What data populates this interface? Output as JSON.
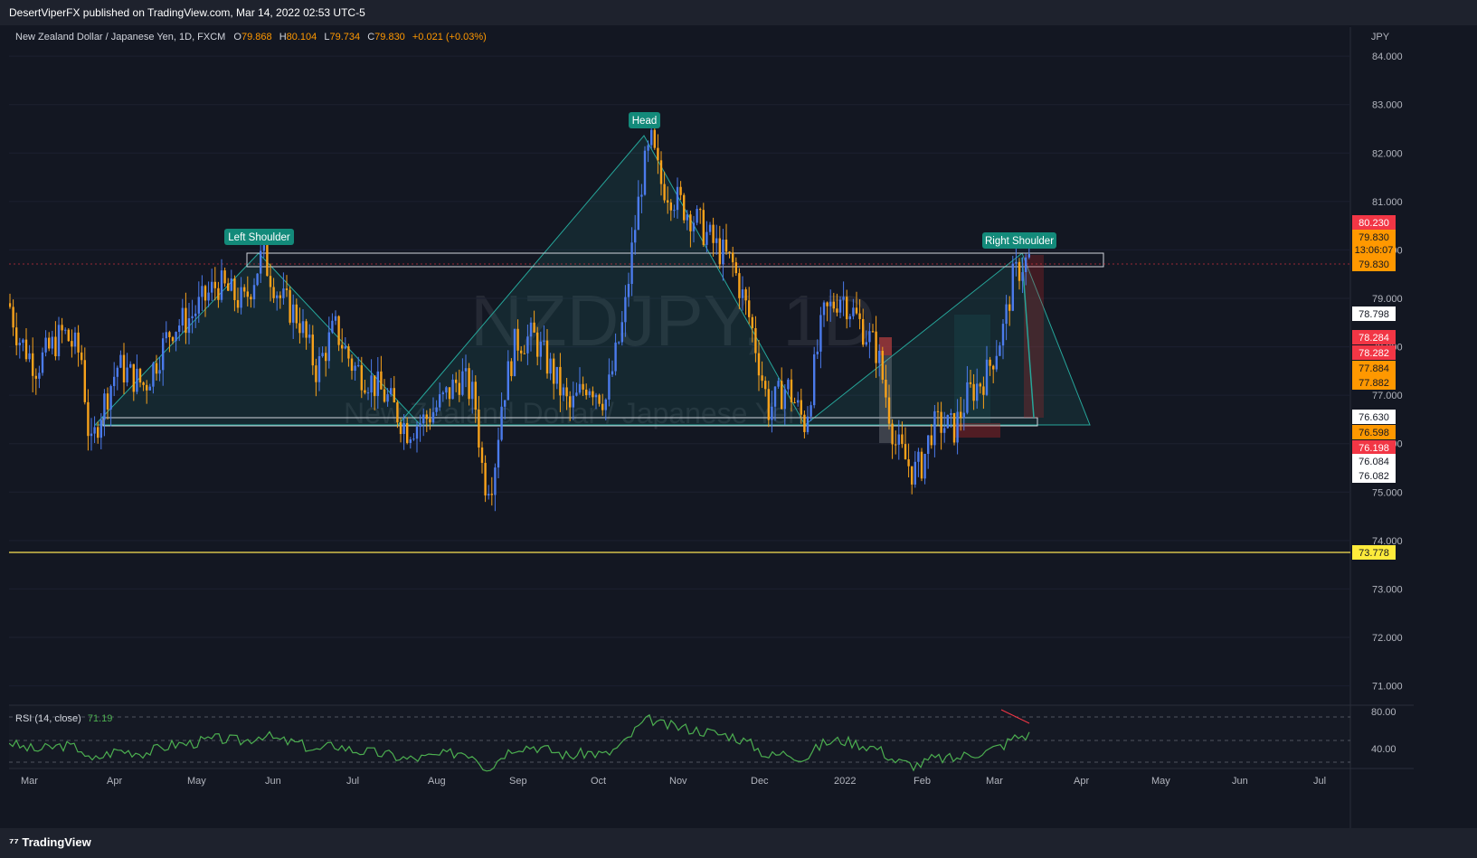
{
  "publisher": "DesertViperFX published on TradingView.com, Mar 14, 2022 02:53 UTC-5",
  "legend": {
    "symbol": "New Zealand Dollar / Japanese Yen, 1D, FXCM",
    "o_label": "O",
    "o": "79.868",
    "h_label": "H",
    "h": "80.104",
    "l_label": "L",
    "l": "79.734",
    "c_label": "C",
    "c": "79.830",
    "change": "+0.021 (+0.03%)"
  },
  "watermark": {
    "main": "NZDJPY, 1D",
    "sub": "New Zealand Dollar / Japanese Yen"
  },
  "currency": "JPY",
  "price_ticks": [
    "84.000",
    "83.000",
    "82.000",
    "81.000",
    "80.000",
    "79.000",
    "78.000",
    "77.000",
    "76.000",
    "75.000",
    "74.000",
    "73.000",
    "72.000",
    "71.000"
  ],
  "price_badges": [
    {
      "text": "80.230",
      "bg": "#f23645",
      "fg": "#ffffff"
    },
    {
      "text": "79.830",
      "bg": "#ff9800",
      "fg": "#131722"
    },
    {
      "text": "13:06:07",
      "bg": "#ff9800",
      "fg": "#131722"
    },
    {
      "text": "79.830",
      "bg": "#ff9800",
      "fg": "#131722"
    },
    {
      "text": "78.798",
      "bg": "#ffffff",
      "fg": "#131722"
    },
    {
      "text": "78.284",
      "bg": "#f23645",
      "fg": "#ffffff"
    },
    {
      "text": "78.282",
      "bg": "#f23645",
      "fg": "#ffffff"
    },
    {
      "text": "77.884",
      "bg": "#ff9800",
      "fg": "#131722"
    },
    {
      "text": "77.882",
      "bg": "#ff9800",
      "fg": "#131722"
    },
    {
      "text": "76.630",
      "bg": "#ffffff",
      "fg": "#131722"
    },
    {
      "text": "76.598",
      "bg": "#ff9800",
      "fg": "#131722"
    },
    {
      "text": "76.198",
      "bg": "#f23645",
      "fg": "#ffffff"
    },
    {
      "text": "76.084",
      "bg": "#ffffff",
      "fg": "#131722"
    },
    {
      "text": "76.082",
      "bg": "#ffffff",
      "fg": "#131722"
    },
    {
      "text": "73.778",
      "bg": "#ffeb3b",
      "fg": "#131722"
    }
  ],
  "pattern_labels": {
    "left": "Left Shoulder",
    "head": "Head",
    "right": "Right Shoulder"
  },
  "rsi": {
    "label": "RSI (14, close)",
    "value": "71.19",
    "ticks": [
      "80.00",
      "40.00"
    ]
  },
  "time_labels": [
    "Mar",
    "Apr",
    "May",
    "Jun",
    "Jul",
    "Aug",
    "Sep",
    "Oct",
    "Nov",
    "Dec",
    "2022",
    "Feb",
    "Mar",
    "Apr",
    "May",
    "Jun",
    "Jul"
  ],
  "footer": {
    "brand": "TradingView"
  },
  "colors": {
    "up": "#4b7bec",
    "down": "#f7a21b",
    "pattern": "#26a69a",
    "support_line": "#d4c04a",
    "rsi_line": "#4caf50"
  },
  "chart_data": {
    "type": "candlestick",
    "title": "New Zealand Dollar / Japanese Yen, 1D, FXCM",
    "ylabel": "JPY",
    "ylim": [
      70.6,
      84.6
    ],
    "close_path": [
      [
        0,
        78.9
      ],
      [
        10,
        78.2
      ],
      [
        30,
        77.6
      ],
      [
        60,
        78.3
      ],
      [
        80,
        77.8
      ],
      [
        90,
        75.8
      ],
      [
        100,
        76.6
      ],
      [
        120,
        77.6
      ],
      [
        150,
        77.2
      ],
      [
        180,
        78.4
      ],
      [
        200,
        78.6
      ],
      [
        230,
        79.3
      ],
      [
        260,
        78.9
      ],
      [
        280,
        79.9
      ],
      [
        300,
        79.0
      ],
      [
        320,
        78.6
      ],
      [
        340,
        77.5
      ],
      [
        360,
        78.4
      ],
      [
        380,
        77.6
      ],
      [
        400,
        77.3
      ],
      [
        420,
        76.9
      ],
      [
        440,
        76.3
      ],
      [
        460,
        76.5
      ],
      [
        480,
        76.9
      ],
      [
        500,
        77.4
      ],
      [
        515,
        76.9
      ],
      [
        525,
        75.2
      ],
      [
        535,
        75.3
      ],
      [
        545,
        76.9
      ],
      [
        560,
        78.1
      ],
      [
        580,
        78.2
      ],
      [
        600,
        77.5
      ],
      [
        620,
        76.7
      ],
      [
        640,
        77.3
      ],
      [
        660,
        76.9
      ],
      [
        680,
        78.6
      ],
      [
        690,
        80.2
      ],
      [
        700,
        81.5
      ],
      [
        710,
        82.2
      ],
      [
        720,
        81.4
      ],
      [
        740,
        81.0
      ],
      [
        760,
        80.6
      ],
      [
        780,
        80.1
      ],
      [
        800,
        79.7
      ],
      [
        820,
        78.5
      ],
      [
        840,
        76.7
      ],
      [
        860,
        77.2
      ],
      [
        880,
        76.4
      ],
      [
        900,
        78.6
      ],
      [
        920,
        79.1
      ],
      [
        940,
        78.5
      ],
      [
        960,
        77.9
      ],
      [
        980,
        76.0
      ],
      [
        1000,
        75.4
      ],
      [
        1010,
        75.6
      ],
      [
        1020,
        76.3
      ],
      [
        1030,
        76.4
      ],
      [
        1045,
        76.3
      ],
      [
        1060,
        77.0
      ],
      [
        1080,
        77.4
      ],
      [
        1100,
        78.4
      ],
      [
        1110,
        79.4
      ],
      [
        1120,
        79.7
      ],
      [
        1130,
        79.83
      ]
    ],
    "annotations": {
      "neckline_zone": [
        76.4,
        76.55
      ],
      "shoulder_zone": [
        79.9,
        80.2
      ],
      "support_line": 73.778,
      "current_price": 79.83
    }
  }
}
